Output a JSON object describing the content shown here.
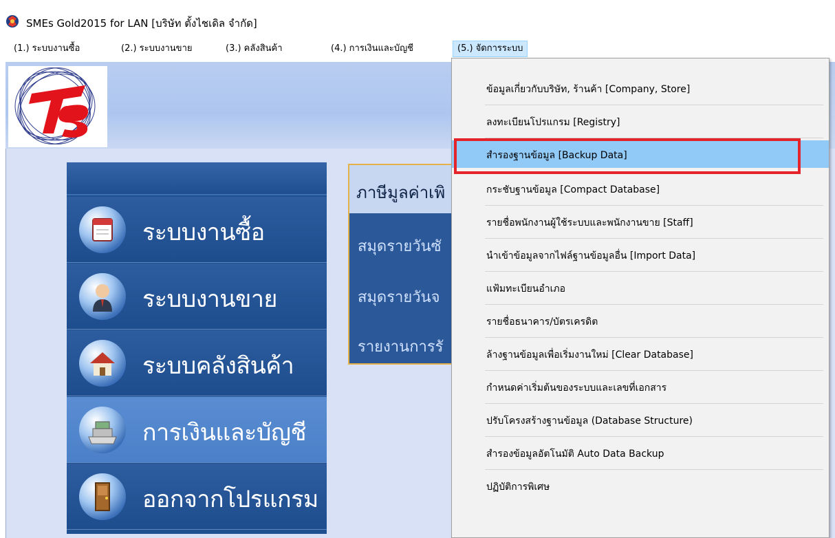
{
  "window": {
    "title": "SMEs Gold2015 for LAN [บริษัท ตั้งไชเดิล จำกัด]",
    "icon": "app-logo-icon"
  },
  "menubar": [
    {
      "label": "(1.) ระบบงานซื้อ"
    },
    {
      "label": "(2.) ระบบงานขาย"
    },
    {
      "label": "(3.) คลังสินค้า"
    },
    {
      "label": "(4.) การเงินและบัญชี"
    },
    {
      "label": "(5.) จัดการระบบ",
      "active": true
    }
  ],
  "nav": [
    {
      "label": "ระบบงานซื้อ",
      "icon": "calendar-icon"
    },
    {
      "label": "ระบบงานขาย",
      "icon": "salesperson-icon"
    },
    {
      "label": "ระบบคลังสินค้า",
      "icon": "house-icon"
    },
    {
      "label": "การเงินและบัญชี",
      "icon": "cash-register-icon",
      "selected": true
    },
    {
      "label": "ออกจากโปรแกรม",
      "icon": "door-icon"
    }
  ],
  "subpanel": {
    "heading": "ภาษีมูลค่าเพิ",
    "items": [
      "สมุดรายวันซั",
      "สมุดรายวันจ",
      "รายงานการรั"
    ]
  },
  "dropdown": [
    {
      "label": "ข้อมูลเกี่ยวกับบริษัท, ร้านค้า [Company, Store]"
    },
    {
      "label": "ลงทะเบียนโปรแกรม [Registry]"
    },
    {
      "label": "สำรองฐานข้อมูล [Backup Data]",
      "hover": true
    },
    {
      "label": "กระชับฐานข้อมูล [Compact Database]"
    },
    {
      "label": "รายชื่อพนักงานผู้ใช้ระบบและพนักงานขาย [Staff]"
    },
    {
      "label": "นำเข้าข้อมูลจากไฟล์ฐานข้อมูลอื่น [Import Data]"
    },
    {
      "label": "แฟ้มทะเบียนอำเภอ"
    },
    {
      "label": "รายชื่อธนาคาร/บัตรเครดิต"
    },
    {
      "label": "ล้างฐานข้อมูลเพื่อเริ่มงานใหม่ [Clear Database]"
    },
    {
      "label": "กำหนดค่าเริ่มต้นของระบบและเลขที่เอกสาร"
    },
    {
      "label": "ปรับโครงสร้างฐานข้อมูล (Database Structure)"
    },
    {
      "label": "สำรองข้อมูลอัตโนมัติ Auto Data Backup"
    },
    {
      "label": "ปฏิบัติการพิเศษ"
    }
  ],
  "colors": {
    "highlight_border": "#e5232b",
    "menu_hover": "#91c9f7",
    "nav_bg": "#1e4f8f"
  }
}
